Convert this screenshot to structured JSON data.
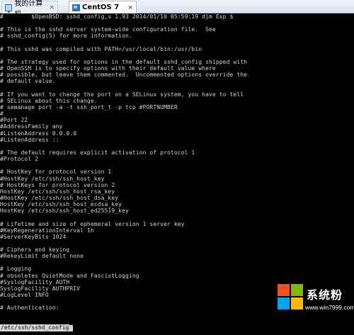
{
  "tabs": [
    {
      "label": "我的计算机",
      "icon": "computer-icon",
      "active": false
    },
    {
      "label": "CentOS 7",
      "icon": "virtual-machine-icon",
      "active": true
    }
  ],
  "tab_close_glyph": "×",
  "terminal": {
    "lines": [
      "#\t$OpenBSD: sshd_config,v 1.93 2014/01/10 05:59:19 djm Exp $",
      "",
      "# This is the sshd server system-wide configuration file.  See",
      "# sshd_config(5) for more information.",
      "",
      "# This sshd was compiled with PATH=/usr/local/bin:/usr/bin",
      "",
      "# The strategy used for options in the default sshd_config shipped with",
      "# OpenSSH is to specify options with their default value where",
      "# possible, but leave them commented.  Uncommented options override the",
      "# default value.",
      "",
      "# If you want to change the port on a SELinux system, you have to tell",
      "# SELinux about this change.",
      "# semanage port -a -t ssh_port_t -p tcp #PORTNUMBER",
      "#",
      "#Port 22",
      "#AddressFamily any",
      "#ListenAddress 0.0.0.0",
      "#ListenAddress ::",
      "",
      "# The default requires explicit activation of protocol 1",
      "#Protocol 2",
      "",
      "# HostKey for protocol version 1",
      "#HostKey /etc/ssh/ssh_host_key",
      "# HostKeys for protocol version 2",
      "HostKey /etc/ssh/ssh_host_rsa_key",
      "#HostKey /etc/ssh/ssh_host_dsa_key",
      "HostKey /etc/ssh/ssh_host_ecdsa_key",
      "HostKey /etc/ssh/ssh_host_ed25519_key",
      "",
      "# Lifetime and size of ephemeral version 1 server key",
      "#KeyRegenerationInterval 1h",
      "#ServerKeyBits 1024",
      "",
      "# Ciphers and keying",
      "#RekeyLimit default none",
      "",
      "# Logging",
      "# obsoletes QuietMode and FascistLogging",
      "#SyslogFacility AUTH",
      "SyslogFacility AUTHPRIV",
      "#LogLevel INFO",
      "",
      "# Authentication:"
    ],
    "status_text": "/etc/ssh/sshd_config"
  },
  "watermark": {
    "title": "系统粉",
    "url": "www.win7999.com",
    "logo_colors": [
      "#f25022",
      "#7fba00",
      "#00a4ef",
      "#ffb900"
    ]
  }
}
